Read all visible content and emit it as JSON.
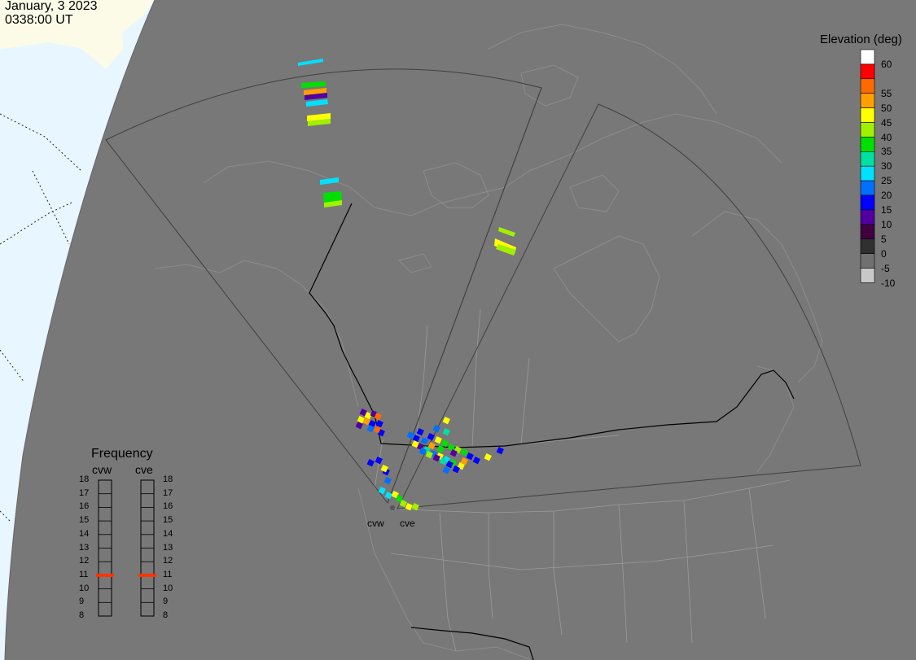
{
  "header": {
    "date": "January, 3 2023",
    "time": "0338:00 UT"
  },
  "elevation_legend": {
    "title": "Elevation (deg)",
    "levels": [
      {
        "label": "60",
        "color": "#ffffff"
      },
      {
        "label": "",
        "color": "#ff0000"
      },
      {
        "label": "55",
        "color": "#ff6a00"
      },
      {
        "label": "50",
        "color": "#ff9f00"
      },
      {
        "label": "45",
        "color": "#ffff00"
      },
      {
        "label": "40",
        "color": "#a0f000"
      },
      {
        "label": "35",
        "color": "#00e000"
      },
      {
        "label": "30",
        "color": "#00e0a0"
      },
      {
        "label": "25",
        "color": "#00e0ff"
      },
      {
        "label": "20",
        "color": "#0070ff"
      },
      {
        "label": "15",
        "color": "#0000ff"
      },
      {
        "label": "10",
        "color": "#5000a0"
      },
      {
        "label": "5",
        "color": "#400040"
      },
      {
        "label": "0",
        "color": "#303030"
      },
      {
        "label": "-5",
        "color": "#707070"
      },
      {
        "label": "-10",
        "color": "#c8c8c8"
      }
    ]
  },
  "frequency_legend": {
    "title": "Frequency",
    "radars": [
      "cvw",
      "cve"
    ],
    "ticks": [
      "18",
      "17",
      "16",
      "15",
      "14",
      "13",
      "12",
      "11",
      "10",
      "9",
      "8"
    ],
    "current_mhz": [
      11,
      11
    ],
    "marker_color": "#ff3300"
  },
  "radar_labels": [
    "cvw",
    "cve"
  ],
  "colors": {
    "ocean": "#e8f6ff",
    "land": "#787878",
    "ice": "#fbfbe8",
    "grid_line": "#000000"
  },
  "echoes": [
    {
      "c": "#00e0ff",
      "pts": [
        [
          366,
          77
        ],
        [
          397,
          72
        ],
        [
          397,
          76
        ],
        [
          366,
          81
        ]
      ]
    },
    {
      "c": "#00e000",
      "pts": [
        [
          370,
          102
        ],
        [
          400,
          100
        ],
        [
          400,
          106
        ],
        [
          370,
          108
        ]
      ]
    },
    {
      "c": "#ff9f00",
      "pts": [
        [
          373,
          111
        ],
        [
          401,
          108
        ],
        [
          401,
          114
        ],
        [
          373,
          117
        ]
      ]
    },
    {
      "c": "#5000a0",
      "pts": [
        [
          374,
          117
        ],
        [
          402,
          114
        ],
        [
          402,
          120
        ],
        [
          374,
          123
        ]
      ]
    },
    {
      "c": "#00e0ff",
      "pts": [
        [
          376,
          125
        ],
        [
          402,
          122
        ],
        [
          403,
          128
        ],
        [
          376,
          131
        ]
      ]
    },
    {
      "c": "#ffff00",
      "pts": [
        [
          377,
          142
        ],
        [
          406,
          139
        ],
        [
          406,
          146
        ],
        [
          377,
          149
        ]
      ]
    },
    {
      "c": "#a0f000",
      "pts": [
        [
          378,
          149
        ],
        [
          406,
          146
        ],
        [
          406,
          152
        ],
        [
          378,
          155
        ]
      ]
    },
    {
      "c": "#00e0ff",
      "pts": [
        [
          393,
          221
        ],
        [
          416,
          218
        ],
        [
          416,
          224
        ],
        [
          393,
          227
        ]
      ]
    },
    {
      "c": "#00e000",
      "pts": [
        [
          397,
          237
        ],
        [
          419,
          235
        ],
        [
          420,
          246
        ],
        [
          398,
          249
        ]
      ]
    },
    {
      "c": "#a0f000",
      "pts": [
        [
          398,
          249
        ],
        [
          420,
          246
        ],
        [
          420,
          252
        ],
        [
          398,
          255
        ]
      ]
    },
    {
      "c": "#a0f000",
      "pts": [
        [
          613,
          279
        ],
        [
          633,
          286
        ],
        [
          631,
          291
        ],
        [
          612,
          284
        ]
      ]
    },
    {
      "c": "#ffff00",
      "pts": [
        [
          608,
          293
        ],
        [
          634,
          304
        ],
        [
          632,
          312
        ],
        [
          607,
          302
        ]
      ]
    },
    {
      "c": "#a0f000",
      "pts": [
        [
          612,
          300
        ],
        [
          634,
          307
        ],
        [
          631,
          314
        ],
        [
          609,
          306
        ]
      ]
    }
  ],
  "cluster_cells": [
    [
      446,
      506,
      "#5000a0"
    ],
    [
      452,
      510,
      "#ffff00"
    ],
    [
      459,
      508,
      "#5000a0"
    ],
    [
      464,
      511,
      "#ff6a00"
    ],
    [
      443,
      515,
      "#ffff00"
    ],
    [
      450,
      517,
      "#ff9f00"
    ],
    [
      457,
      520,
      "#0000ff"
    ],
    [
      466,
      520,
      "#0000ff"
    ],
    [
      441,
      522,
      "#5000a0"
    ],
    [
      455,
      526,
      "#0070ff"
    ],
    [
      468,
      531,
      "#0000ff"
    ],
    [
      463,
      527,
      "#ff6a00"
    ],
    [
      548,
      516,
      "#ffff00"
    ],
    [
      536,
      526,
      "#0070ff"
    ],
    [
      548,
      530,
      "#00e0a0"
    ],
    [
      504,
      534,
      "#0070ff"
    ],
    [
      511,
      538,
      "#0000ff"
    ],
    [
      516,
      530,
      "#0000ff"
    ],
    [
      521,
      541,
      "#0070ff"
    ],
    [
      529,
      536,
      "#0000ff"
    ],
    [
      538,
      540,
      "#ffff00"
    ],
    [
      546,
      544,
      "#00e000"
    ],
    [
      554,
      549,
      "#00e000"
    ],
    [
      562,
      552,
      "#a0f000"
    ],
    [
      570,
      555,
      "#00e000"
    ],
    [
      577,
      560,
      "#0000ff"
    ],
    [
      585,
      565,
      "#0000ff"
    ],
    [
      614,
      553,
      "#0000ff"
    ],
    [
      599,
      561,
      "#ffff00"
    ],
    [
      516,
      548,
      "#5000a0"
    ],
    [
      524,
      552,
      "#00e0a0"
    ],
    [
      532,
      557,
      "#0070ff"
    ],
    [
      540,
      560,
      "#ffff00"
    ],
    [
      548,
      564,
      "#00e0ff"
    ],
    [
      556,
      568,
      "#00e000"
    ],
    [
      566,
      572,
      "#ffff00"
    ],
    [
      560,
      576,
      "#0000ff"
    ],
    [
      552,
      570,
      "#0000ff"
    ],
    [
      544,
      566,
      "#00e0a0"
    ],
    [
      536,
      562,
      "#5000a0"
    ],
    [
      527,
      558,
      "#a0f000"
    ],
    [
      519,
      554,
      "#0070ff"
    ],
    [
      510,
      545,
      "#ffff00"
    ],
    [
      530,
      547,
      "#ff9f00"
    ],
    [
      541,
      551,
      "#00e000"
    ],
    [
      557,
      556,
      "#5000a0"
    ],
    [
      570,
      566,
      "#ff9f00"
    ],
    [
      548,
      577,
      "#0070ff"
    ],
    [
      455,
      568,
      "#0000ff"
    ],
    [
      465,
      565,
      "#0000ff"
    ],
    [
      474,
      579,
      "#0000ff"
    ],
    [
      476,
      590,
      "#0070ff"
    ],
    [
      469,
      602,
      "#00e0ff"
    ],
    [
      477,
      608,
      "#00e0ff"
    ],
    [
      485,
      607,
      "#ffff00"
    ],
    [
      490,
      612,
      "#00e000"
    ],
    [
      495,
      618,
      "#a0f000"
    ],
    [
      502,
      622,
      "#ffff00"
    ],
    [
      510,
      622,
      "#a0f000"
    ],
    [
      472,
      575,
      "#ffff00"
    ]
  ]
}
